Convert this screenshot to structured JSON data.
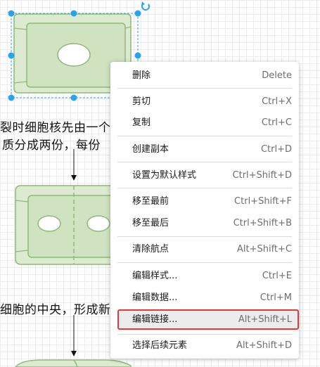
{
  "captions": {
    "line1": "裂时细胞核先由一个",
    "line2": "质分成两份，每份",
    "line3": "细胞的中央，形成新"
  },
  "context_menu": {
    "items": [
      {
        "label": "删除",
        "shortcut": "Delete"
      },
      {
        "label": "剪切",
        "shortcut": "Ctrl+X"
      },
      {
        "label": "复制",
        "shortcut": "Ctrl+C"
      },
      {
        "label": "创建副本",
        "shortcut": "Ctrl+D"
      },
      {
        "label": "设置为默认样式",
        "shortcut": "Ctrl+Shift+D"
      },
      {
        "label": "移至最前",
        "shortcut": "Ctrl+Shift+F"
      },
      {
        "label": "移至最后",
        "shortcut": "Ctrl+Shift+B"
      },
      {
        "label": "清除航点",
        "shortcut": "Alt+Shift+C"
      },
      {
        "label": "编辑样式...",
        "shortcut": "Ctrl+E"
      },
      {
        "label": "编辑数据...",
        "shortcut": "Ctrl+M"
      },
      {
        "label": "编辑链接...",
        "shortcut": "Alt+Shift+L"
      },
      {
        "label": "选择后续元素",
        "shortcut": "Alt+Shift+D"
      }
    ],
    "highlighted_label": "编辑链接..."
  },
  "colors": {
    "cell_fill": "#dcebd0",
    "cell_stroke": "#8fb87a",
    "selection": "#29a3f0",
    "highlight_border": "#e53935"
  },
  "icons": [
    "rotate-icon",
    "arrow-down-icon"
  ]
}
